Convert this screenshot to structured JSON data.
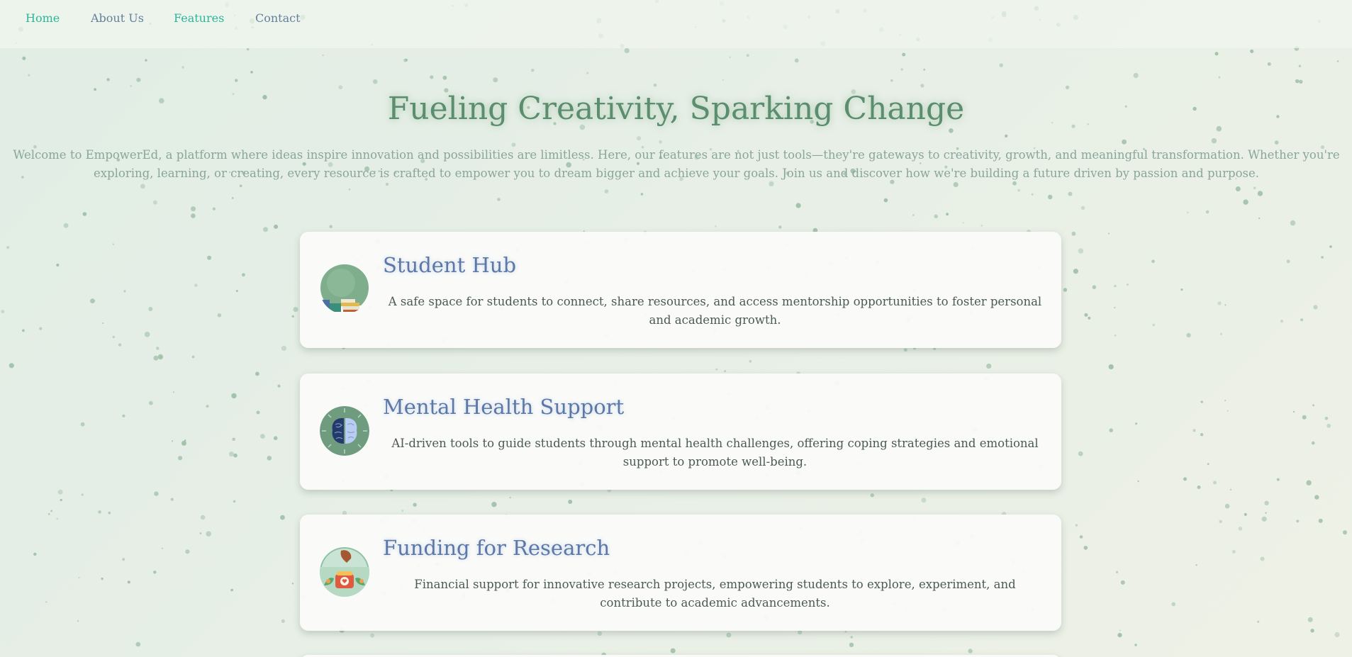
{
  "nav": {
    "items": [
      {
        "label": "Home"
      },
      {
        "label": "About Us"
      },
      {
        "label": "Features"
      },
      {
        "label": "Contact"
      }
    ]
  },
  "hero": {
    "title": "Fueling Creativity, Sparking Change",
    "description": "Welcome to EmpowerEd, a platform where ideas inspire innovation and possibilities are limitless. Here, our features are not just tools—they're gateways to creativity, growth, and meaningful transformation. Whether you're exploring, learning, or creating, every resource is crafted to empower you to dream bigger and achieve your goals. Join us and discover how we're building a future driven by passion and purpose."
  },
  "features": [
    {
      "title": "Student Hub",
      "description": "A safe space for students to connect, share resources, and access mentorship opportunities to foster personal and academic growth.",
      "icon": "books-icon"
    },
    {
      "title": "Mental Health Support",
      "description": "AI-driven tools to guide students through mental health challenges, offering coping strategies and emotional support to promote well-being.",
      "icon": "brain-icon"
    },
    {
      "title": "Funding for Research",
      "description": "Financial support for innovative research projects, empowering students to explore, experiment, and contribute to academic advancements.",
      "icon": "funding-icon"
    }
  ],
  "colors": {
    "accent": "#2bb79a",
    "nav_text": "#64809c",
    "hero_title": "#5b8e6e",
    "card_title": "#5b78a8",
    "speckle": "#8fb59a"
  }
}
